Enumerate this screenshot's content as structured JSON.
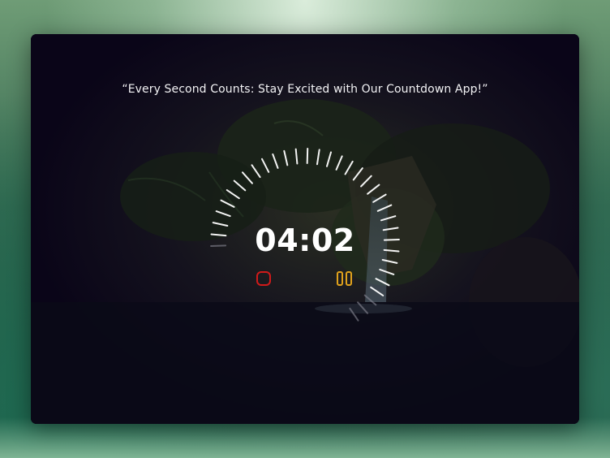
{
  "app": {
    "quote": "“Every Second Counts: Stay Excited with Our Countdown App!”"
  },
  "timer": {
    "display": "04:02"
  },
  "controls": {
    "stop_icon": "stop-icon",
    "pause_icon": "pause-icon",
    "stop_color": "#d11a1a",
    "pause_color": "#e0a21c"
  },
  "dial": {
    "tick_color": "#ffffff",
    "dim_tick_color": "#8a8a96"
  },
  "colors": {
    "card_background": "#0a0518",
    "text": "#f2f2f4"
  }
}
